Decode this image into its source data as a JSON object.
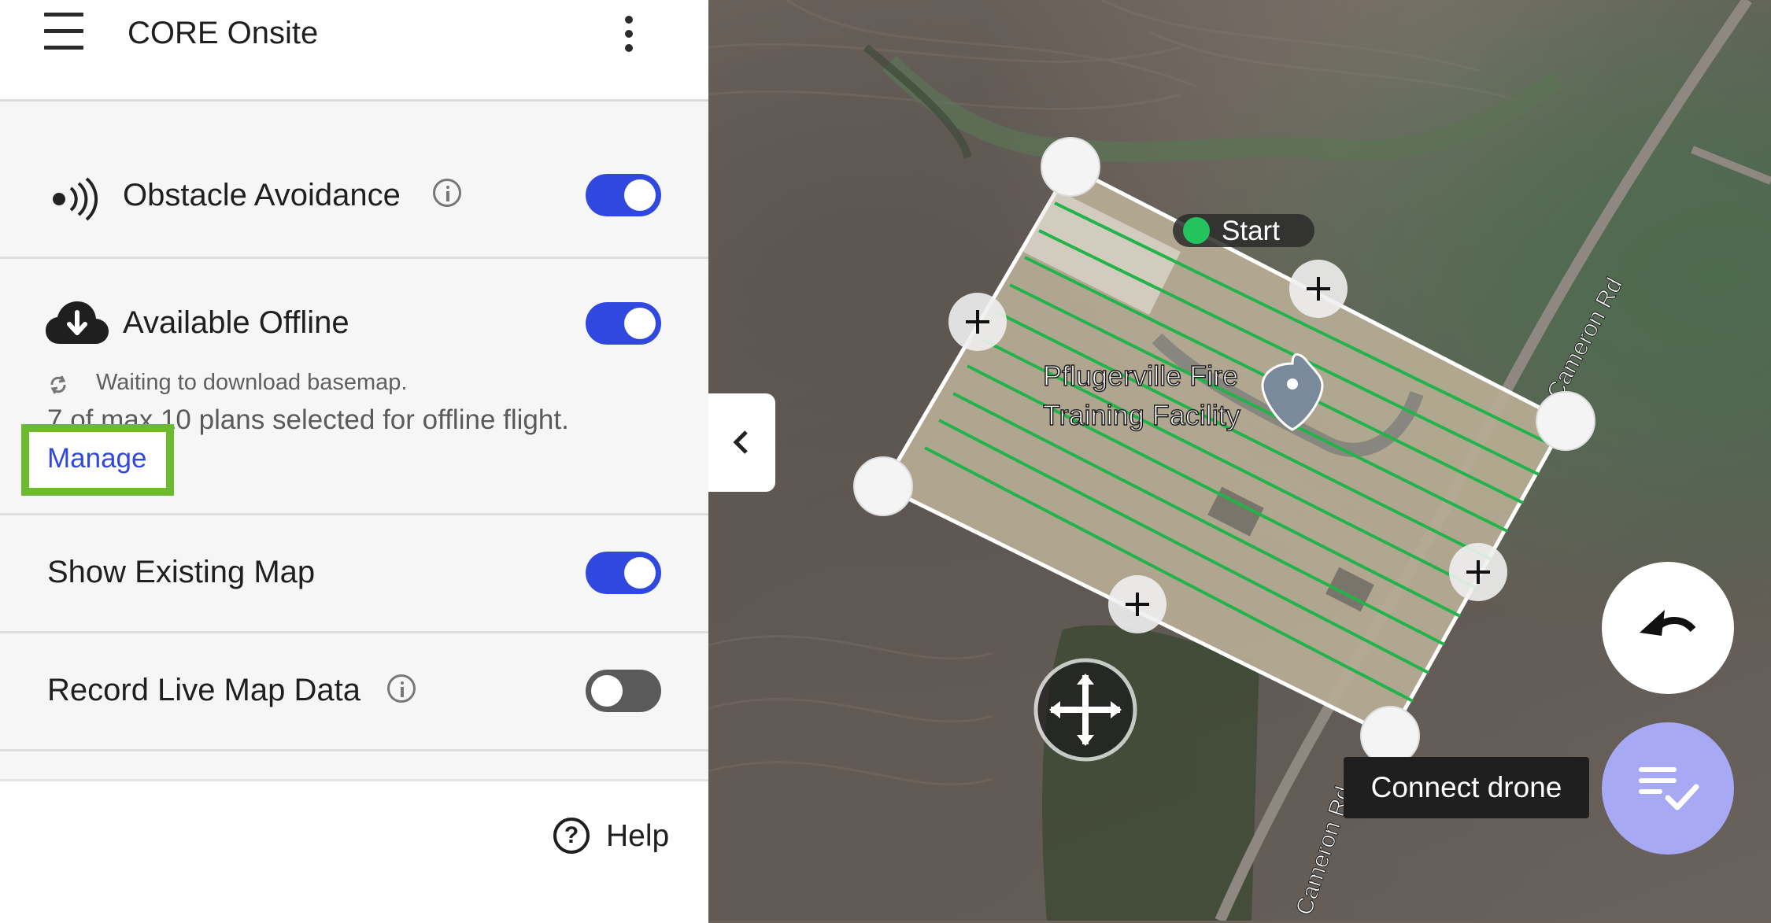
{
  "app": {
    "title": "CORE Onsite"
  },
  "settings": {
    "obstacle_avoidance": {
      "label": "Obstacle Avoidance",
      "enabled": true
    },
    "available_offline": {
      "label": "Available Offline",
      "enabled": true,
      "status": "Waiting to download basemap.",
      "plans_summary": "7 of max 10 plans selected for offline flight.",
      "manage_label": "Manage"
    },
    "show_existing_map": {
      "label": "Show Existing Map",
      "enabled": true
    },
    "record_live_map": {
      "label": "Record Live Map Data",
      "enabled": false
    }
  },
  "footer": {
    "help_label": "Help"
  },
  "map": {
    "start_label": "Start",
    "place_label_line1": "Pflugerville Fire",
    "place_label_line2": "Training Facility",
    "road_label_top": "Cameron Rd",
    "road_label_bottom": "Cameron Rd",
    "connect_tooltip": "Connect drone"
  },
  "colors": {
    "accent": "#3148e0",
    "highlight": "#6cbb2f",
    "flight_lines": "#22b34a",
    "start_dot": "#23c45e",
    "fab_checklist": "#a7a9f4"
  }
}
